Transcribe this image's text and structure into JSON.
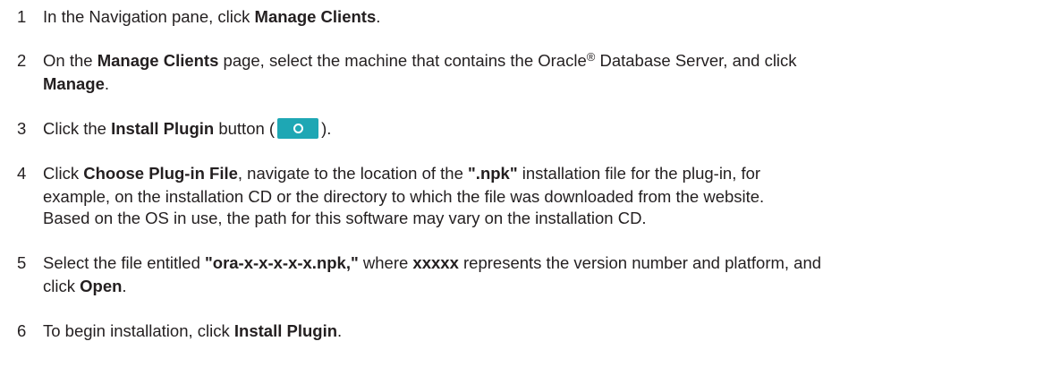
{
  "steps": [
    {
      "number": "1",
      "parts": [
        "In the Navigation pane, click ",
        "Manage Clients",
        "."
      ]
    },
    {
      "number": "2",
      "parts": [
        "On the ",
        "Manage Clients",
        " page, select the machine that contains the Oracle",
        "®",
        " Database Server, and click",
        "Manage",
        "."
      ]
    },
    {
      "number": "3",
      "parts": [
        "Click the ",
        "Install Plugin",
        " button (",
        ")."
      ]
    },
    {
      "number": "4",
      "parts": [
        "Click ",
        "Choose Plug-in File",
        ", navigate to the location of the ",
        "\".npk\"",
        " installation file for the plug-in, for",
        "example, on the installation CD or the directory to which the file was downloaded from the website."
      ],
      "note": "Based on the OS in use, the path for this software may vary on the installation CD."
    },
    {
      "number": "5",
      "parts": [
        "Select the file entitled ",
        "\"ora-x-x-x-x-x.npk,\"",
        " where ",
        "xxxxx",
        " represents the version number and platform, and",
        "click ",
        "Open",
        "."
      ]
    },
    {
      "number": "6",
      "parts": [
        "To begin installation, click ",
        "Install Plugin",
        "."
      ]
    }
  ],
  "icons": {
    "install_plugin_button": "add-plugin-icon",
    "button_color": "#1ea7b4"
  }
}
